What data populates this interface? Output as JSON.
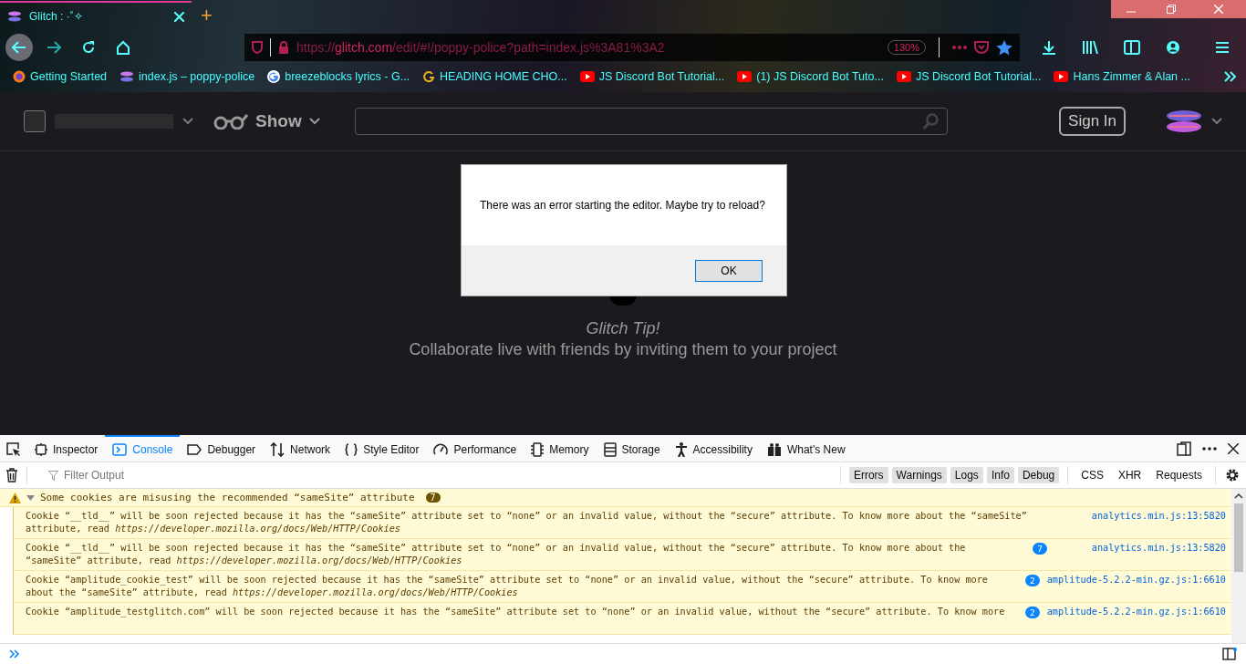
{
  "browser": {
    "tab_title": "Glitch : ·˚✧",
    "new_tab": "+",
    "url": {
      "scheme": "https://",
      "domain": "glitch.com",
      "path": "/edit/#!/poppy-police?path=index.js%3A81%3A2"
    },
    "zoom": "130%",
    "bookmarks": [
      {
        "label": "Getting Started",
        "kind": "firefox"
      },
      {
        "label": "index.js – poppy-police",
        "kind": "glitch"
      },
      {
        "label": "breezeblocks lyrics - G...",
        "kind": "google"
      },
      {
        "label": "HEADING HOME CHO...",
        "kind": "letter"
      },
      {
        "label": "JS Discord Bot Tutorial...",
        "kind": "youtube"
      },
      {
        "label": "(1) JS Discord Bot Tuto...",
        "kind": "youtube"
      },
      {
        "label": "JS Discord Bot Tutorial...",
        "kind": "youtube"
      },
      {
        "label": "Hans Zimmer & Alan ...",
        "kind": "youtube"
      }
    ]
  },
  "header": {
    "show": "Show",
    "sign_in": "Sign In"
  },
  "dialog": {
    "message": "There was an error starting the editor. Maybe try to reload?",
    "button": "OK"
  },
  "tip": {
    "title": "Glitch Tip!",
    "text": "Collaborate live with friends by inviting them to your project"
  },
  "devtools": {
    "tabs": [
      {
        "label": "Inspector",
        "selected": false
      },
      {
        "label": "Console",
        "selected": true
      },
      {
        "label": "Debugger",
        "selected": false
      },
      {
        "label": "Network",
        "selected": false
      },
      {
        "label": "Style Editor",
        "selected": false
      },
      {
        "label": "Performance",
        "selected": false
      },
      {
        "label": "Memory",
        "selected": false
      },
      {
        "label": "Storage",
        "selected": false
      },
      {
        "label": "Accessibility",
        "selected": false
      },
      {
        "label": "What's New",
        "selected": false
      }
    ],
    "filter": {
      "placeholder": "Filter Output"
    },
    "levels": [
      {
        "label": "Errors",
        "on": true
      },
      {
        "label": "Warnings",
        "on": true
      },
      {
        "label": "Logs",
        "on": true
      },
      {
        "label": "Info",
        "on": true
      },
      {
        "label": "Debug",
        "on": true
      }
    ],
    "types": [
      {
        "label": "CSS",
        "on": false
      },
      {
        "label": "XHR",
        "on": false
      },
      {
        "label": "Requests",
        "on": false
      }
    ],
    "group": {
      "text": "Some cookies are misusing the recommended “sameSite” attribute",
      "count": "7",
      "expanded": true
    },
    "messages": [
      {
        "text": "Cookie “__tld__” will be soon rejected because it has the “sameSite” attribute set to “none” or an invalid value, without the “secure” attribute. To know more about the “sameSite” attribute, read *https://developer.mozilla.org/docs/Web/HTTP/Cookies*",
        "source": "analytics.min.js:13:5820"
      },
      {
        "text": "Cookie “__tld__” will be soon rejected because it has the “sameSite” attribute set to “none” or an invalid value, without the “secure” attribute. To know more about the “sameSite” attribute, read *https://developer.mozilla.org/docs/Web/HTTP/Cookies*",
        "count": "7",
        "source": "analytics.min.js:13:5820"
      },
      {
        "text": "Cookie “amplitude_cookie_test” will be soon rejected because it has the “sameSite” attribute set to “none” or an invalid value, without the “secure” attribute. To know more about the “sameSite” attribute, read *https://developer.mozilla.org/docs/Web/HTTP/Cookies*",
        "count": "2",
        "source": "amplitude-5.2.2-min.gz.js:1:6610"
      },
      {
        "text": "Cookie “amplitude_testglitch.com” will be soon rejected because it has the “sameSite” attribute set to “none” or an invalid value, without the “secure” attribute. To know more",
        "count": "2",
        "source": "amplitude-5.2.2-min.gz.js:1:6610"
      }
    ]
  }
}
